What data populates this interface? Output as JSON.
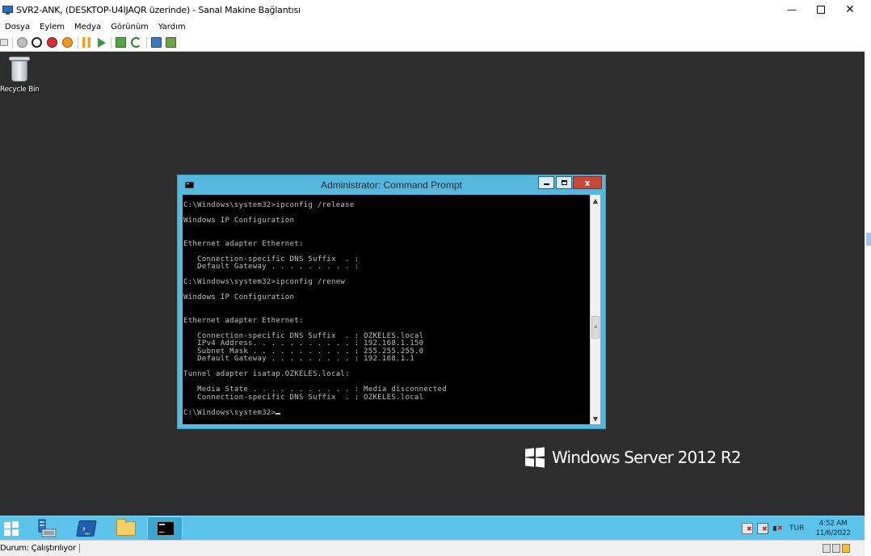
{
  "host": {
    "title": "SVR2-ANK, (DESKTOP-U4IJAQR üzerinde) - Sanal Makine Bağlantısı",
    "menu": [
      "Dosya",
      "Eylem",
      "Medya",
      "Görünüm",
      "Yardım"
    ],
    "toolbar_icons": [
      "ctrl-alt-del-icon",
      "start-icon",
      "turn-off-icon",
      "shutdown-icon",
      "save-icon",
      "pause-icon",
      "resume-icon",
      "checkpoint-icon",
      "revert-icon",
      "enhanced-session-icon",
      "share-icon"
    ],
    "status": "Durum: Çalıştırılıyor"
  },
  "desktop": {
    "recycle_bin_label": "Recycle Bin",
    "branding": "Windows Server 2012 R2"
  },
  "cmd": {
    "title": "Administrator: Command Prompt",
    "close_glyph": "x",
    "lines": [
      "C:\\Windows\\system32>ipconfig /release",
      "",
      "Windows IP Configuration",
      "",
      "",
      "Ethernet adapter Ethernet:",
      "",
      "   Connection-specific DNS Suffix  . :",
      "   Default Gateway . . . . . . . . . :",
      "",
      "C:\\Windows\\system32>ipconfig /renew",
      "",
      "Windows IP Configuration",
      "",
      "",
      "Ethernet adapter Ethernet:",
      "",
      "   Connection-specific DNS Suffix  . : OZKELES.local",
      "   IPv4 Address. . . . . . . . . . . : 192.168.1.150",
      "   Subnet Mask . . . . . . . . . . . : 255.255.255.0",
      "   Default Gateway . . . . . . . . . : 192.168.1.1",
      "",
      "Tunnel adapter isatap.OZKELES.local:",
      "",
      "   Media State . . . . . . . . . . . : Media disconnected",
      "   Connection-specific DNS Suffix  . : OZKELES.local",
      "",
      "C:\\Windows\\system32>"
    ]
  },
  "taskbar": {
    "lang": "TUR",
    "time": "4:52 AM",
    "date": "11/6/2022"
  },
  "colors": {
    "accent": "#5cc4ea",
    "vm_background": "#2d2d2d",
    "cmd_background": "#000000",
    "cmd_text": "#c0c0c0"
  }
}
